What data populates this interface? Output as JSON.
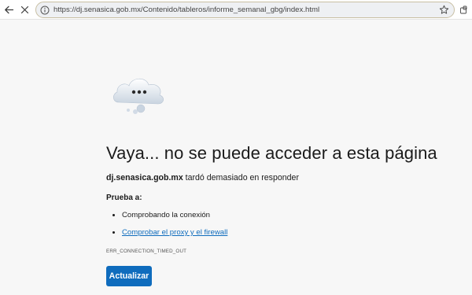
{
  "browser": {
    "url": "https://dj.senasica.gob.mx/Contenido/tableros/informe_semanal_gbg/index.html",
    "icons": [
      "back-arrow-icon",
      "stop-icon",
      "info-icon",
      "star-icon",
      "extension-icon"
    ]
  },
  "error_page": {
    "title": "Vaya... no se puede acceder a esta página",
    "host": "dj.senasica.gob.mx",
    "message": " tardó demasiado en responder",
    "try_label": "Prueba a:",
    "suggestions": [
      {
        "text": "Comprobando la conexión",
        "link": false
      },
      {
        "text": "Comprobar el proxy y el firewall",
        "link": true
      }
    ],
    "error_code": "ERR_CONNECTION_TIMED_OUT",
    "reload_label": "Actualizar"
  },
  "colors": {
    "accent": "#0f6cbd",
    "address_border": "#c8bfa3",
    "page_bg": "#f7f7f7"
  }
}
